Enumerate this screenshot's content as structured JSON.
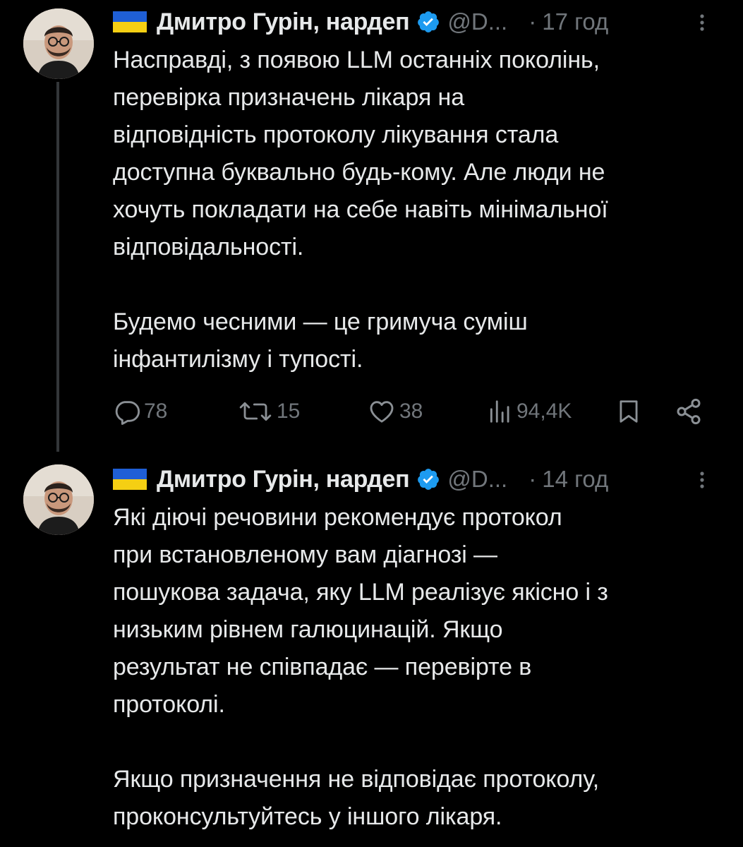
{
  "tweets": [
    {
      "author": {
        "flag_colors": [
          "#1f5fd6",
          "#f5cf13"
        ],
        "name": "Дмитро Гурін, нардеп",
        "handle": "@D...",
        "verified_color": "#1d9bf0"
      },
      "separator": "·",
      "time": "17 год",
      "text": "Насправді, з появою LLM останніх поколінь,\nперевірка призначень лікаря на\nвідповідність протоколу лікування стала\nдоступна буквально будь-кому. Але люди не\nхочуть покладати на себе навіть мінімальної\nвідповідальності.\n\nБудемо чесними — це гримуча суміш\nінфантилізму і тупості.",
      "stats": {
        "replies": "78",
        "retweets": "15",
        "likes": "38",
        "views": "94,4K"
      }
    },
    {
      "author": {
        "flag_colors": [
          "#1f5fd6",
          "#f5cf13"
        ],
        "name": "Дмитро Гурін, нардеп",
        "handle": "@D...",
        "verified_color": "#1d9bf0"
      },
      "separator": "·",
      "time": "14 год",
      "text": "Які діючі речовини рекомендує протокол\nпри встановленому вам діагнозі —\nпошукова задача, яку LLM реалізує якісно і з\nнизьким рівнем галюцинацій. Якщо\nрезультат не співпадає — перевірте в\nпротоколі.\n\nЯкщо призначення не відповідає протоколу,\nпроконсультуйтесь у іншого лікаря."
    }
  ],
  "colors": {
    "background": "#000000",
    "text": "#e7e9ea",
    "secondary": "#71767b",
    "thread_line": "#333639"
  }
}
